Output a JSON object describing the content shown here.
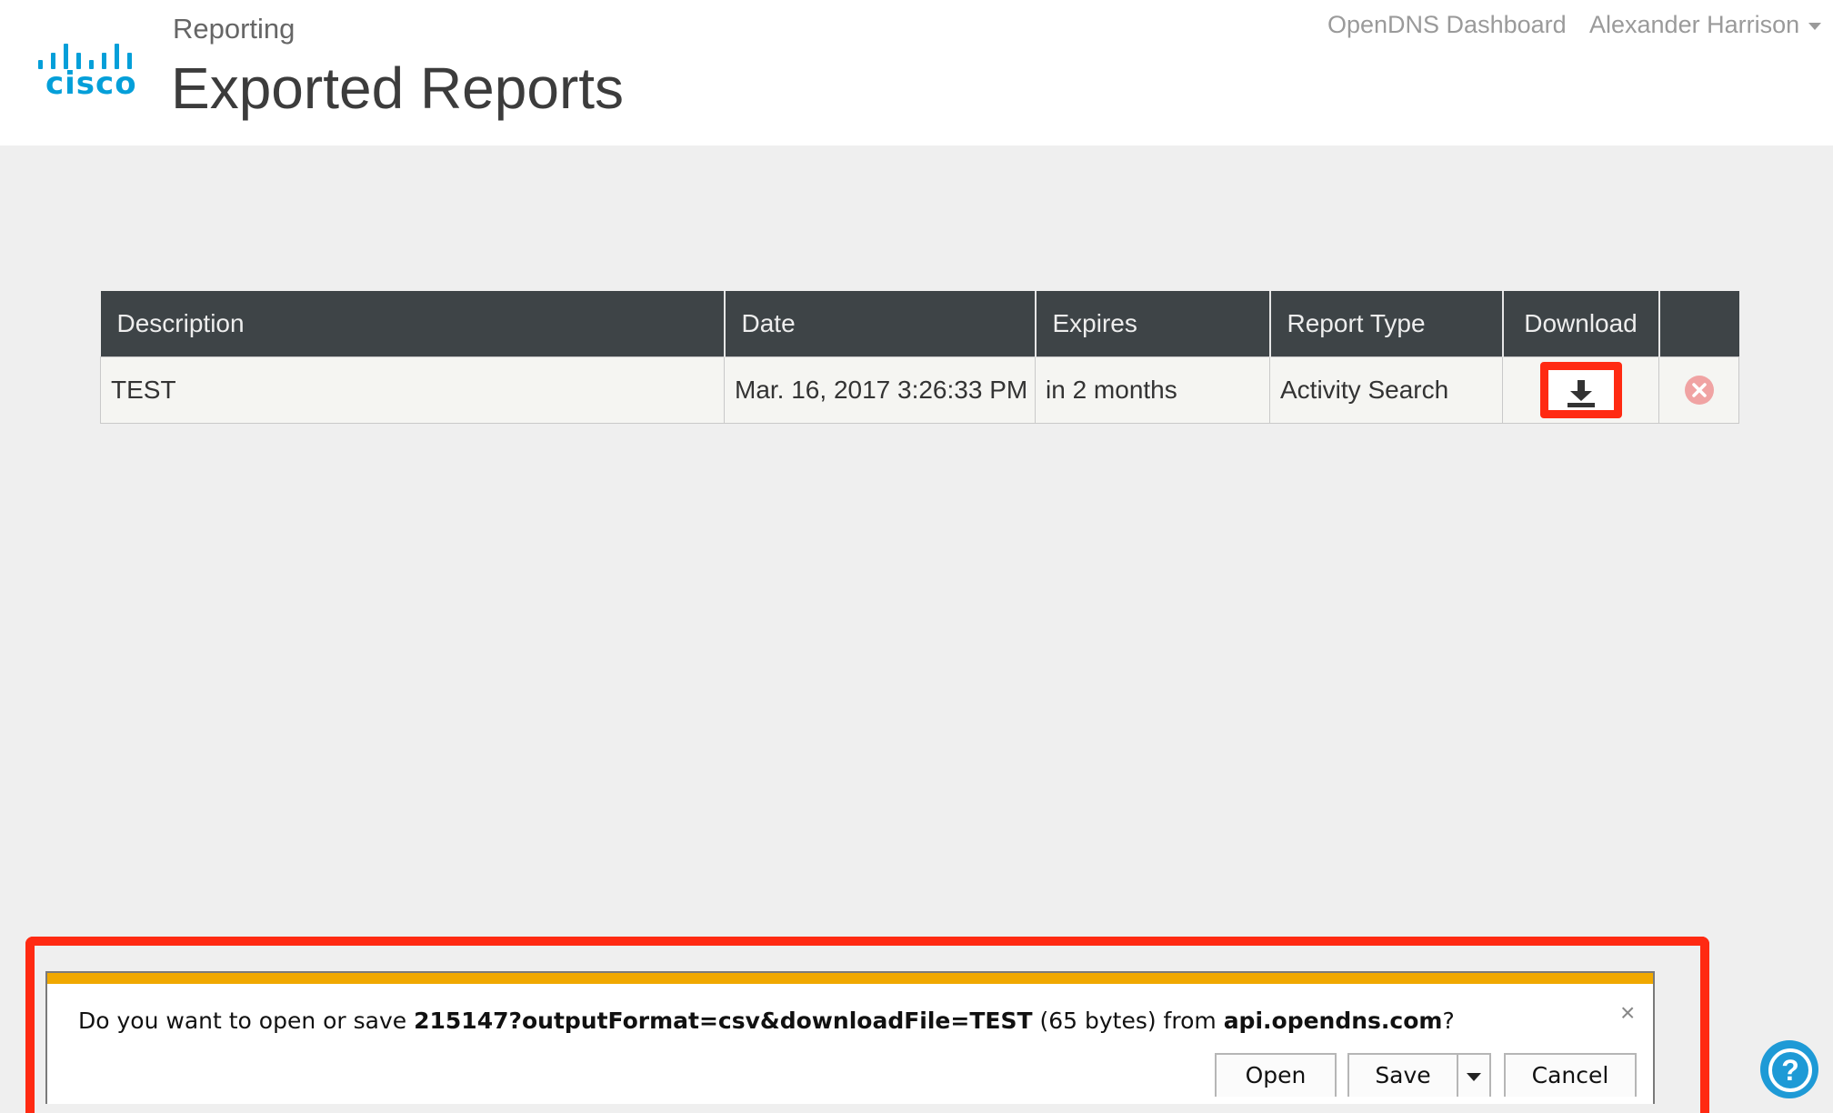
{
  "header": {
    "logo_text": "cisco",
    "section": "Reporting",
    "title": "Exported Reports",
    "dashboard_link": "OpenDNS Dashboard",
    "user_name": "Alexander Harrison"
  },
  "table": {
    "columns": [
      "Description",
      "Date",
      "Expires",
      "Report Type",
      "Download",
      ""
    ],
    "rows": [
      {
        "description": "TEST",
        "date": "Mar. 16, 2017 3:26:33 PM",
        "expires": "in 2 months",
        "report_type": "Activity Search",
        "download_icon": "download-icon",
        "delete_icon": "close-circle-icon"
      }
    ]
  },
  "download_bar": {
    "prefix": "Do you want to open or save ",
    "filename": "215147?outputFormat=csv&downloadFile=TEST",
    "size": " (65 bytes) from ",
    "host": "api.opendns.com",
    "suffix": "?",
    "close": "×",
    "open_label": "Open",
    "save_label": "Save",
    "cancel_label": "Cancel"
  },
  "help": {
    "label": "?"
  },
  "colors": {
    "brand": "#049fd9",
    "header_bg": "#3e4447",
    "highlight": "#ff2a12",
    "notification_stripe": "#f0a800"
  }
}
